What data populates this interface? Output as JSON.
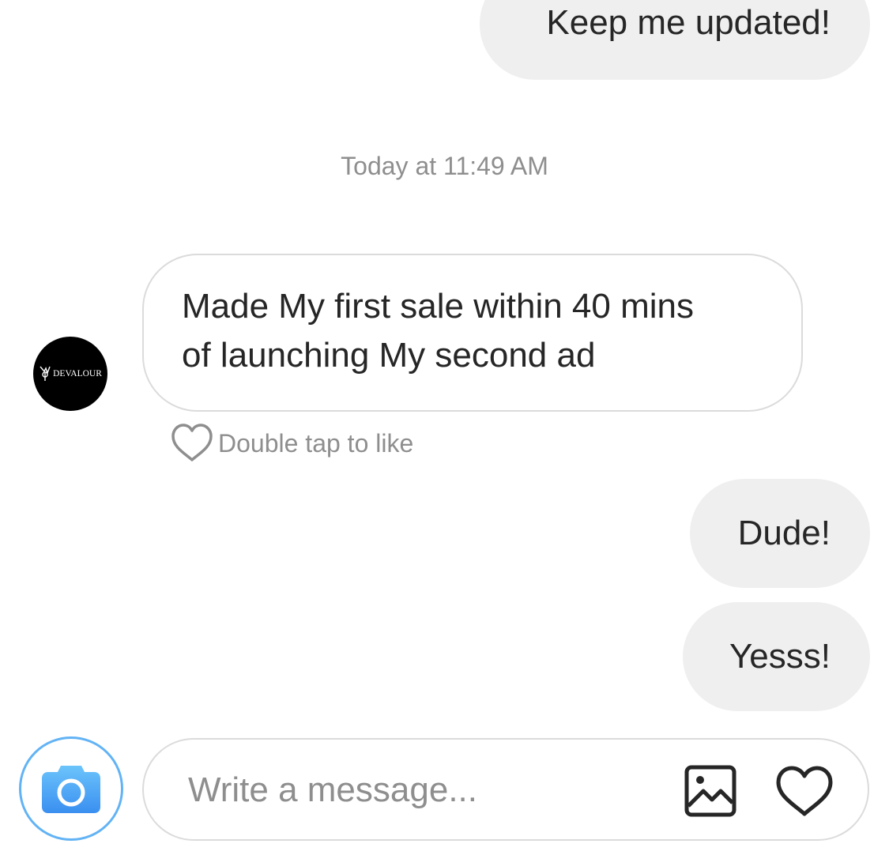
{
  "thread": {
    "messages": [
      {
        "direction": "outgoing",
        "text": "Keep me updated!"
      },
      {
        "direction": "timestamp",
        "text": "Today at 11:49 AM"
      },
      {
        "direction": "incoming",
        "sender": "DEVALOUR",
        "lines": [
          "Made My first sale within 40 mins",
          "of launching My second ad"
        ],
        "like_hint": "Double tap to like"
      },
      {
        "direction": "outgoing",
        "text": "Dude!"
      },
      {
        "direction": "outgoing",
        "text": "Yesss!"
      }
    ]
  },
  "composer": {
    "placeholder": "Write a message...",
    "icons": [
      "camera-icon",
      "gallery-icon",
      "heart-icon"
    ]
  },
  "colors": {
    "outgoing_bubble": "#efefef",
    "incoming_border": "#dbdbdb",
    "camera_blue": "#3897f0",
    "muted_text": "#8e8e8e",
    "text": "#262626"
  }
}
